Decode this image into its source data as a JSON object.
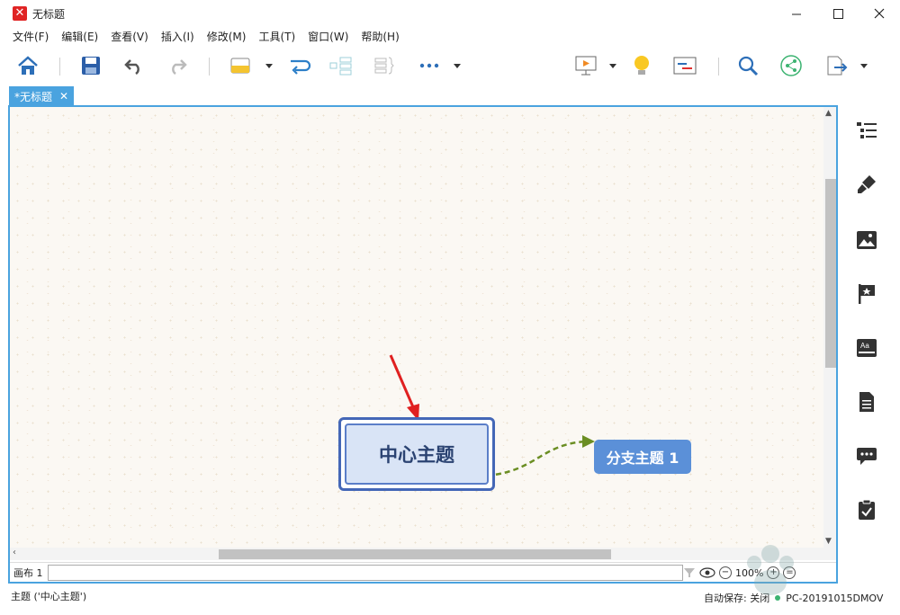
{
  "window": {
    "title": "无标题"
  },
  "menu": [
    "文件(F)",
    "编辑(E)",
    "查看(V)",
    "插入(I)",
    "修改(M)",
    "工具(T)",
    "窗口(W)",
    "帮助(H)"
  ],
  "toolbar": {
    "icons": [
      "home-icon",
      "save-icon",
      "undo-icon",
      "redo-icon",
      "topic-icon",
      "relationship-icon",
      "structure-icon",
      "boundary-icon",
      "more-icon",
      "presentation-icon",
      "brainstorm-icon",
      "gantt-icon",
      "search-icon",
      "share-icon",
      "export-icon"
    ]
  },
  "tab": {
    "label": "*无标题",
    "close": "✕"
  },
  "mindmap": {
    "central_topic": "中心主题",
    "branch_topic": "分支主题 1"
  },
  "sheet": {
    "label": "画布 1"
  },
  "zoom": {
    "value": "100%"
  },
  "status": {
    "selection": "主题 ('中心主题')",
    "autosave": "自动保存: 关闭",
    "computer": "PC-20191015DMOV"
  },
  "colors": {
    "accent": "#4aa3df",
    "central_border": "#4467b7",
    "central_fill": "#d9e4f6",
    "branch_fill": "#5b90d8",
    "connector": "#6b8e23",
    "arrow": "#e02020"
  }
}
